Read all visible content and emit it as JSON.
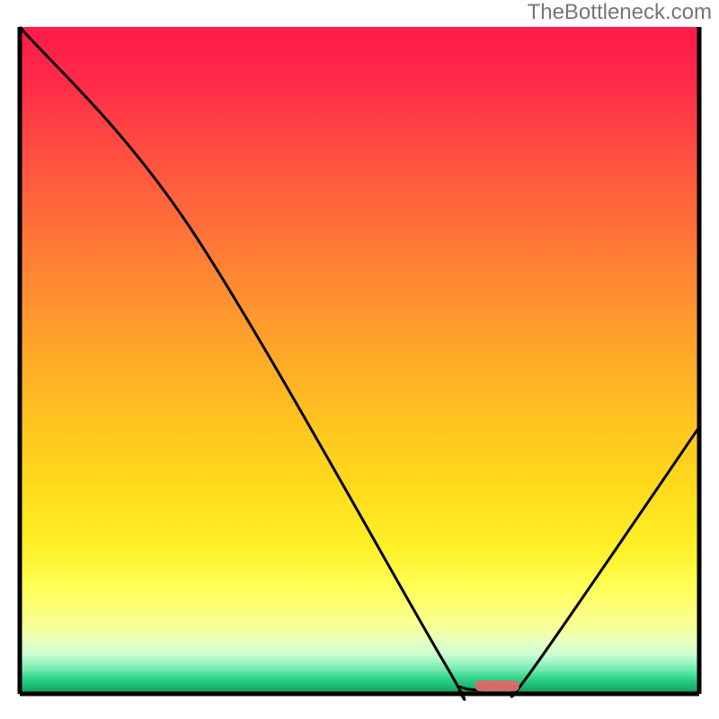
{
  "attribution": "TheBottleneck.com",
  "chart_data": {
    "type": "line",
    "xlim": [
      0,
      100
    ],
    "ylim": [
      0,
      100
    ],
    "line": [
      {
        "x": 0,
        "y": 100
      },
      {
        "x": 25,
        "y": 70
      },
      {
        "x": 62,
        "y": 5.5
      },
      {
        "x": 65,
        "y": 1
      },
      {
        "x": 72,
        "y": 1
      },
      {
        "x": 75,
        "y": 3
      },
      {
        "x": 100,
        "y": 40
      }
    ],
    "marker": {
      "x_from": 67,
      "x_to": 73.5,
      "y": 1.2
    },
    "gradient_stops": [
      {
        "pct": 0.0,
        "color": "#ff1a4b"
      },
      {
        "pct": 0.08,
        "color": "#ff2a49"
      },
      {
        "pct": 0.18,
        "color": "#ff4c42"
      },
      {
        "pct": 0.28,
        "color": "#ff6a3a"
      },
      {
        "pct": 0.38,
        "color": "#ff8832"
      },
      {
        "pct": 0.48,
        "color": "#ffa529"
      },
      {
        "pct": 0.58,
        "color": "#ffc021"
      },
      {
        "pct": 0.68,
        "color": "#ffd81c"
      },
      {
        "pct": 0.78,
        "color": "#fff028"
      },
      {
        "pct": 0.84,
        "color": "#ffff55"
      },
      {
        "pct": 0.9,
        "color": "#f8ff99"
      },
      {
        "pct": 0.92,
        "color": "#e8ffc0"
      },
      {
        "pct": 0.94,
        "color": "#cfffd0"
      },
      {
        "pct": 0.95,
        "color": "#a8f7c7"
      },
      {
        "pct": 0.965,
        "color": "#6de8ae"
      },
      {
        "pct": 0.975,
        "color": "#34d98e"
      },
      {
        "pct": 0.99,
        "color": "#1ab670"
      },
      {
        "pct": 1.0,
        "color": "#149055"
      }
    ]
  }
}
